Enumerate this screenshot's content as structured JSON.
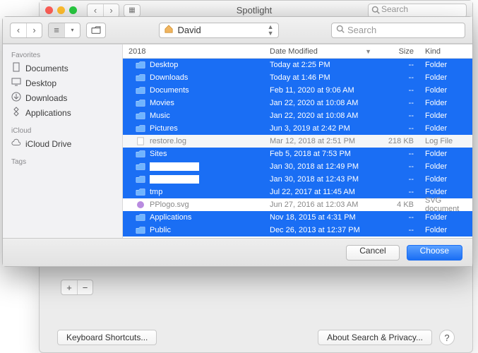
{
  "bg_window": {
    "title": "Spotlight",
    "search_placeholder": "Search",
    "bottom": {
      "shortcuts": "Keyboard Shortcuts...",
      "privacy": "About Search & Privacy...",
      "help": "?"
    }
  },
  "dialog": {
    "path_label": "David",
    "search_placeholder": "Search",
    "sidebar": {
      "favorites_label": "Favorites",
      "favorites": [
        {
          "icon": "doc",
          "label": "Documents"
        },
        {
          "icon": "desktop",
          "label": "Desktop"
        },
        {
          "icon": "down",
          "label": "Downloads"
        },
        {
          "icon": "app",
          "label": "Applications"
        }
      ],
      "icloud_label": "iCloud",
      "icloud": [
        {
          "icon": "cloud",
          "label": "iCloud Drive"
        }
      ],
      "tags_label": "Tags"
    },
    "columns": {
      "name": "2018",
      "date": "Date Modified",
      "size": "Size",
      "kind": "Kind"
    },
    "rows": [
      {
        "sel": true,
        "icon": "folder",
        "name": "Desktop",
        "date": "Today at 2:25 PM",
        "size": "--",
        "kind": "Folder"
      },
      {
        "sel": true,
        "icon": "folder",
        "name": "Downloads",
        "date": "Today at 1:46 PM",
        "size": "--",
        "kind": "Folder"
      },
      {
        "sel": true,
        "icon": "folder",
        "name": "Documents",
        "date": "Feb 11, 2020 at 9:06 AM",
        "size": "--",
        "kind": "Folder"
      },
      {
        "sel": true,
        "icon": "folder",
        "name": "Movies",
        "date": "Jan 22, 2020 at 10:08 AM",
        "size": "--",
        "kind": "Folder"
      },
      {
        "sel": true,
        "icon": "folder",
        "name": "Music",
        "date": "Jan 22, 2020 at 10:08 AM",
        "size": "--",
        "kind": "Folder"
      },
      {
        "sel": true,
        "icon": "folder",
        "name": "Pictures",
        "date": "Jun 3, 2019 at 2:42 PM",
        "size": "--",
        "kind": "Folder"
      },
      {
        "sel": false,
        "icon": "file",
        "name": "restore.log",
        "date": "Mar 12, 2018 at 2:51 PM",
        "size": "218 KB",
        "kind": "Log File"
      },
      {
        "sel": true,
        "icon": "folder",
        "name": "Sites",
        "date": "Feb 5, 2018 at 7:53 PM",
        "size": "--",
        "kind": "Folder"
      },
      {
        "sel": true,
        "icon": "folder",
        "redacted": true,
        "name": "",
        "date": "Jan 30, 2018 at 12:49 PM",
        "size": "--",
        "kind": "Folder"
      },
      {
        "sel": true,
        "icon": "folder",
        "redacted": true,
        "name": "",
        "date": "Jan 30, 2018 at 12:43 PM",
        "size": "--",
        "kind": "Folder"
      },
      {
        "sel": true,
        "icon": "folder",
        "name": "tmp",
        "date": "Jul 22, 2017 at 11:45 AM",
        "size": "--",
        "kind": "Folder"
      },
      {
        "sel": false,
        "icon": "svg",
        "name": "PPlogo.svg",
        "date": "Jun 27, 2016 at 12:03 AM",
        "size": "4 KB",
        "kind": "SVG document"
      },
      {
        "sel": true,
        "icon": "folder",
        "name": "Applications",
        "date": "Nov 18, 2015 at 4:31 PM",
        "size": "--",
        "kind": "Folder"
      },
      {
        "sel": true,
        "icon": "folder",
        "name": "Public",
        "date": "Dec 26, 2013 at 12:37 PM",
        "size": "--",
        "kind": "Folder"
      }
    ],
    "footer": {
      "cancel": "Cancel",
      "choose": "Choose"
    }
  }
}
